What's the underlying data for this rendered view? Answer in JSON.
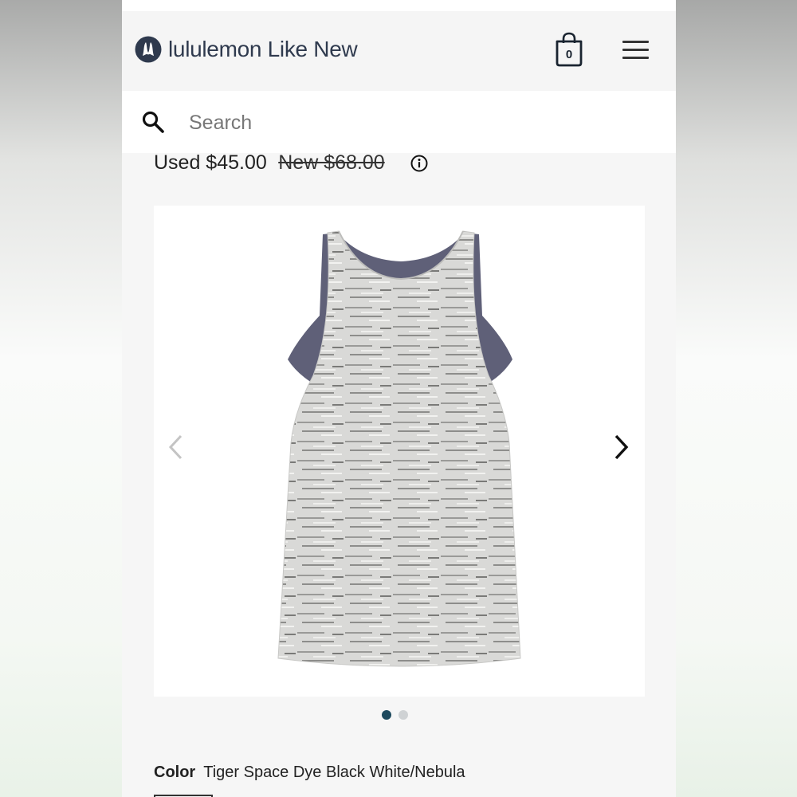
{
  "header": {
    "brand": "lululemon Like New",
    "cart_count": "0"
  },
  "search": {
    "placeholder": "Search"
  },
  "price": {
    "used": "Used $45.00",
    "new": "New $68.00"
  },
  "gallery": {
    "image_count": 2,
    "active_index": 0
  },
  "product": {
    "color_label": "Color",
    "color_value": "Tiger Space Dye Black White/Nebula"
  },
  "icons": {
    "logo": "lululemon-logo-icon",
    "bag": "shopping-bag-icon",
    "menu": "hamburger-menu-icon",
    "search": "search-icon",
    "info": "info-icon",
    "prev": "chevron-left-icon",
    "next": "chevron-right-icon"
  },
  "colors": {
    "brand_text": "#2f3a4e",
    "dot_active": "#1e4a5e",
    "dot_inactive": "#cfd2d4",
    "nebula": "#5f6078"
  }
}
